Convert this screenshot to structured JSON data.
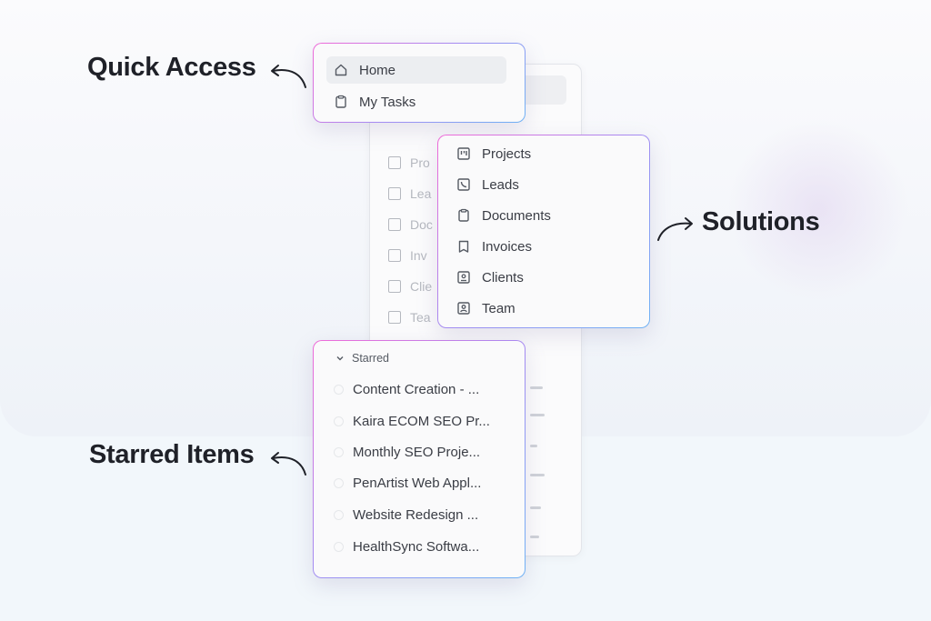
{
  "callouts": {
    "quick_access": "Quick Access",
    "solutions": "Solutions",
    "starred_items": "Starred Items"
  },
  "quick_access": {
    "items": [
      {
        "label": "Home",
        "icon": "home-icon",
        "active": true
      },
      {
        "label": "My Tasks",
        "icon": "clipboard-icon",
        "active": false
      }
    ]
  },
  "solutions": {
    "items": [
      {
        "label": "Projects",
        "icon": "board-icon"
      },
      {
        "label": "Leads",
        "icon": "phone-icon"
      },
      {
        "label": "Documents",
        "icon": "clipboard-icon"
      },
      {
        "label": "Invoices",
        "icon": "bookmark-icon"
      },
      {
        "label": "Clients",
        "icon": "contact-icon"
      },
      {
        "label": "Team",
        "icon": "user-icon"
      }
    ]
  },
  "starred": {
    "header": "Starred",
    "items": [
      "Content Creation - ...",
      "Kaira ECOM SEO Pr...",
      "Monthly SEO Proje...",
      "PenArtist Web Appl...",
      "Website Redesign ...",
      "HealthSync Softwa..."
    ]
  },
  "ghost_sidebar": {
    "rows": [
      "Pro",
      "Lea",
      "Doc",
      "Inv",
      "Clie",
      "Tea"
    ]
  }
}
